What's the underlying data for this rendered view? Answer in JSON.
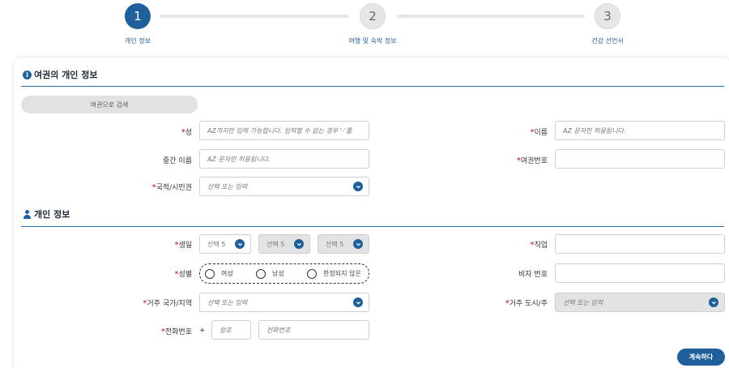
{
  "stepper": {
    "steps": [
      {
        "number": "1",
        "label": "개인 정보"
      },
      {
        "number": "2",
        "label": "여행 및 숙박 정보"
      },
      {
        "number": "3",
        "label": "건강 선언서"
      }
    ]
  },
  "passport_section": {
    "title": "여권의 개인 정보",
    "search_button": "여권으로 검색",
    "last_name": {
      "label": "성",
      "placeholder": "AZ까지만 입력 가능합니다. 입력할 수 없는 경우 '-'를"
    },
    "first_name": {
      "label": "이름",
      "placeholder": "AZ 문자만 허용됩니다."
    },
    "middle_name": {
      "label": "중간 이름",
      "placeholder": "AZ 문자만 허용됩니다."
    },
    "passport_number": {
      "label": "여권번호",
      "placeholder": ""
    },
    "nationality": {
      "label": "국적/시민권",
      "placeholder": "선택 또는 입력"
    }
  },
  "personal_section": {
    "title": "개인 정보",
    "birth": {
      "label": "생일",
      "day": "선택 5",
      "month": "선택 5",
      "year": "선택 5"
    },
    "occupation": {
      "label": "직업",
      "placeholder": ""
    },
    "gender": {
      "label": "성별",
      "options": [
        "여성",
        "남성",
        "한정되지 않은"
      ]
    },
    "visa": {
      "label": "비자 번호",
      "placeholder": ""
    },
    "country": {
      "label": "거주 국가/지역",
      "placeholder": "선택 또는 입력"
    },
    "city": {
      "label": "거주 도시/주",
      "placeholder": "선택 또는 입력"
    },
    "phone": {
      "label": "전화번호",
      "plus": "+",
      "code_placeholder": "암호",
      "number_placeholder": "전화번호"
    }
  },
  "actions": {
    "continue": "계속하다"
  },
  "colors": {
    "primary": "#1f5f9b",
    "required": "#d0021b",
    "inactive_step": "#e6e6e6"
  }
}
